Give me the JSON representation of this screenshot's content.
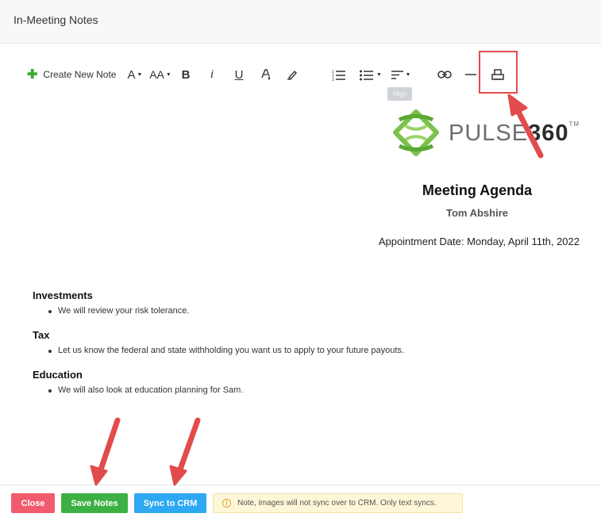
{
  "header": {
    "title": "In-Meeting Notes"
  },
  "toolbar": {
    "create_note_label": "Create New Note",
    "font_color_label": "A",
    "font_size_label": "AA",
    "bold_label": "B",
    "italic_label": "i",
    "underline_label": "U",
    "tooltip": "Align",
    "icons": [
      "plus-icon",
      "font-color-icon",
      "font-size-icon",
      "bold-icon",
      "italic-icon",
      "underline-icon",
      "text-color-icon",
      "highlighter-icon",
      "numbered-list-icon",
      "bulleted-list-icon",
      "align-icon",
      "link-icon",
      "horizontal-rule-icon",
      "print-icon"
    ]
  },
  "logo": {
    "brand": "PULSE",
    "brand_num": "360",
    "tm": "TM"
  },
  "agenda": {
    "title": "Meeting Agenda",
    "name": "Tom Abshire",
    "date": "Appointment Date: Monday, April 11th, 2022"
  },
  "sections": [
    {
      "heading": "Investments",
      "item": "We will review your risk tolerance."
    },
    {
      "heading": "Tax",
      "item": "Let us know the federal and state withholding you want us to apply to your future payouts."
    },
    {
      "heading": "Education",
      "item": "We will also look at education planning for Sam."
    }
  ],
  "footer": {
    "close_label": "Close",
    "save_label": "Save Notes",
    "sync_label": "Sync to CRM",
    "note_text": "Note, images will not sync over to CRM. Only text syncs."
  },
  "colors": {
    "highlight": "#e24b4b",
    "close": "#f25b6e",
    "save": "#3cb043",
    "sync": "#2ea8f0",
    "logo_green": "#7cc04b"
  }
}
